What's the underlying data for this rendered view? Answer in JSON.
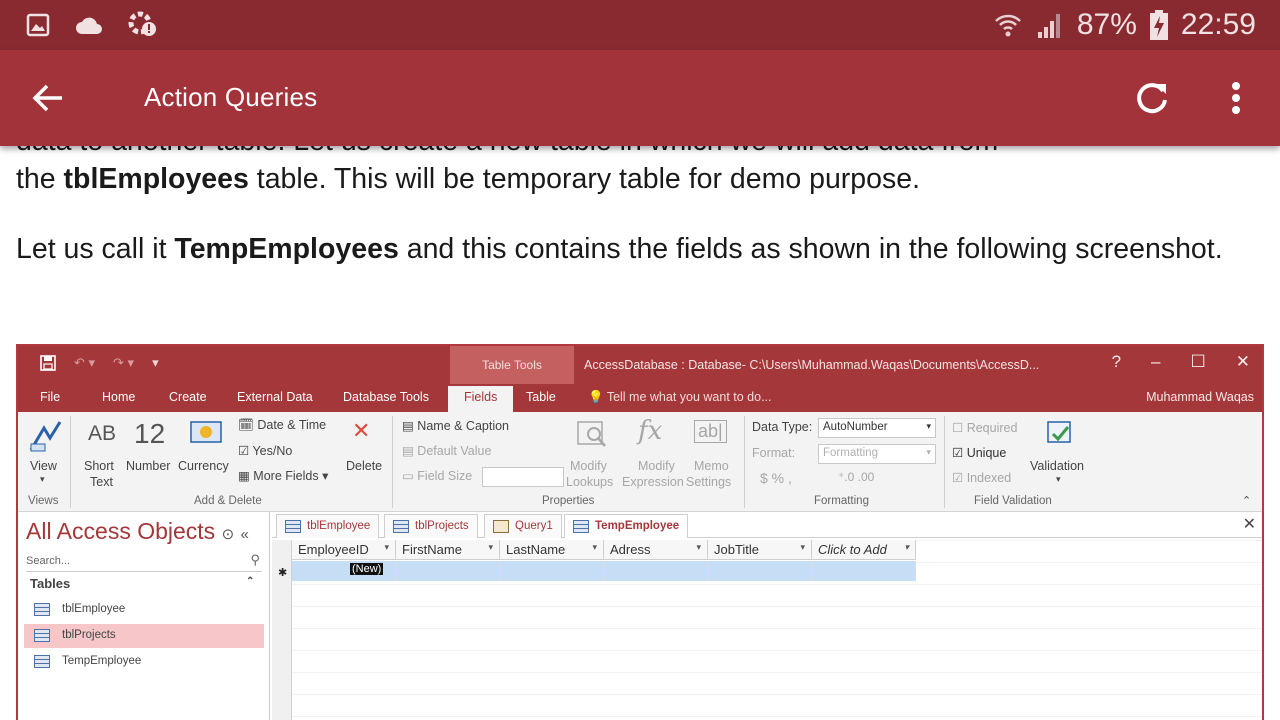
{
  "status_bar": {
    "battery": "87%",
    "time": "22:59",
    "icons": [
      "image-notification-icon",
      "cloud-icon",
      "sync-error-icon",
      "wifi-icon",
      "signal-icon",
      "battery-charging-icon"
    ]
  },
  "app_bar": {
    "title": "Action Queries"
  },
  "article": {
    "line1_partial": "data to another table. Let us create a new table in which we will add data from",
    "p1_prefix": "the ",
    "p1_bold": "tblEmployees",
    "p1_suffix": " table. This will be temporary table for demo purpose.",
    "p2_prefix": "Let us call it ",
    "p2_bold": "TempEmployees",
    "p2_suffix": " and this contains the fields as shown in the following screenshot."
  },
  "access": {
    "title_bar": {
      "table_tools": "Table Tools",
      "path": "AccessDatabase : Database- C:\\Users\\Muhammad.Waqas\\Documents\\AccessD...",
      "help": "?",
      "minimize": "–",
      "maximize": "☐",
      "close": "✕"
    },
    "tabs": {
      "file": "File",
      "home": "Home",
      "create": "Create",
      "external": "External Data",
      "dbtools": "Database Tools",
      "fields": "Fields",
      "table": "Table",
      "tell": "Tell me what you want to do...",
      "user": "Muhammad Waqas"
    },
    "ribbon": {
      "view": "View",
      "ab": "AB",
      "twelve": "12",
      "short_text_1": "Short",
      "short_text_2": "Text",
      "number": "Number",
      "currency": "Currency",
      "date_time": "Date & Time",
      "yes_no": "Yes/No",
      "more_fields": "More Fields",
      "delete": "Delete",
      "name_caption": "Name & Caption",
      "default_value": "Default Value",
      "field_size": "Field Size",
      "modify_lookups_1": "Modify",
      "modify_lookups_2": "Lookups",
      "modify_expr_1": "Modify",
      "modify_expr_2": "Expression",
      "memo_1": "Memo",
      "memo_2": "Settings",
      "data_type_label": "Data Type:",
      "data_type_value": "AutoNumber",
      "format_label": "Format:",
      "format_value": "Formatting",
      "currency_symbols": "$  %  ,",
      "required": "Required",
      "unique": "Unique",
      "indexed": "Indexed",
      "validation": "Validation",
      "group_views": "Views",
      "group_add_delete": "Add & Delete",
      "group_properties": "Properties",
      "group_formatting": "Formatting",
      "group_field_validation": "Field Validation"
    },
    "nav": {
      "header": "All Access Objects",
      "search_placeholder": "Search...",
      "section": "Tables",
      "items": [
        "tblEmployee",
        "tblProjects",
        "TempEmployee"
      ]
    },
    "doc_tabs": [
      "tblEmployee",
      "tblProjects",
      "Query1",
      "TempEmployee"
    ],
    "columns": [
      "EmployeeID",
      "FirstName",
      "LastName",
      "Adress",
      "JobTitle",
      "Click to Add"
    ],
    "new_row_value": "(New)"
  }
}
